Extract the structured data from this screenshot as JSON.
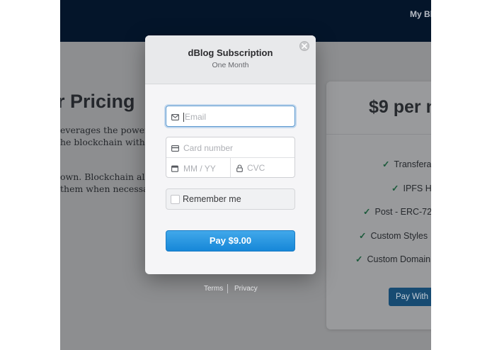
{
  "background_site": {
    "nav_link": "My Bl",
    "heading": "r Pricing",
    "paragraph_lines": [
      "everages the power o",
      "he blockchain with l",
      "",
      "own. Blockchain allow",
      "them when necessar"
    ],
    "price_title": "$9 per n",
    "features": [
      "Transfera",
      "IPFS H",
      "Post - ERC-72",
      "Custom Styles",
      "Custom Domain"
    ],
    "pay_with_label": "Pay With"
  },
  "modal": {
    "title": "dBlog Subscription",
    "subtitle": "One Month",
    "email_placeholder": "Email",
    "card_number_placeholder": "Card number",
    "expiry_placeholder": "MM / YY",
    "cvc_placeholder": "CVC",
    "remember_label": "Remember me",
    "pay_button_label": "Pay $9.00"
  },
  "footer": {
    "terms": "Terms",
    "privacy": "Privacy"
  },
  "colors": {
    "accent": "#1687d8",
    "nav_background": "#04152a",
    "check_green": "#1d5b3c"
  }
}
